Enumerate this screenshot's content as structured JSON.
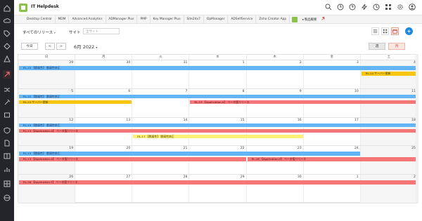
{
  "app": {
    "title": "IT Helpdesk"
  },
  "tabs": [
    "Desktop Central",
    "MDM",
    "Advanced Analytics",
    "ADManager Plus",
    "PMP",
    "Key Manager Plus",
    "Site24x7",
    "OpManager",
    "ADSelfService",
    "Zoho Creator App"
  ],
  "tab_extra": "製品概要",
  "filters": {
    "scope_label": "すべてのリリース",
    "site_label": "サイト",
    "site_placeholder": "全サイト"
  },
  "nav": {
    "today": "今日",
    "prev": "<",
    "next": ">",
    "month": "6月 2022",
    "week": "週",
    "month_view": "月"
  },
  "calendar": {
    "dow": [
      "日",
      "月",
      "火",
      "水",
      "木",
      "金",
      "土"
    ],
    "weeks": [
      {
        "days": [
          "29",
          "30",
          "31",
          "1",
          "2",
          "3",
          "4"
        ],
        "events": [
          {
            "label": "RL-15 【脆弱性】 脆弱性修正",
            "color": "blue",
            "start": 0,
            "span": 7,
            "row": 0
          },
          {
            "label": "RL-14 サーバー更新",
            "color": "yellow",
            "start": 6,
            "span": 1,
            "row": 1
          }
        ]
      },
      {
        "days": [
          "5",
          "6",
          "7",
          "8",
          "9",
          "10",
          "11"
        ],
        "events": [
          {
            "label": "RL-15 【脆弱性】 脆弱性修正",
            "color": "blue",
            "start": 0,
            "span": 7,
            "row": 0
          },
          {
            "label": "RL-14 サーバー更新",
            "color": "yellow",
            "start": 0,
            "span": 2,
            "row": 1
          },
          {
            "label": "RL-13 【Application-X】 ベータ版リリース",
            "color": "red",
            "start": 3,
            "span": 4,
            "row": 1
          }
        ]
      },
      {
        "days": [
          "12",
          "13",
          "14",
          "15",
          "16",
          "17",
          "18"
        ],
        "events": [
          {
            "label": "RL-15 【脆弱性】 脆弱性修正",
            "color": "blue",
            "start": 0,
            "span": 7,
            "row": 0
          },
          {
            "label": "RL-13 【Application-X】 ベータ版リリース",
            "color": "red",
            "start": 0,
            "span": 7,
            "row": 1
          },
          {
            "label": "RL-17 【脆弱性】 脆弱性修正",
            "color": "lightyellow",
            "start": 2,
            "span": 3,
            "row": 2
          }
        ]
      },
      {
        "days": [
          "19",
          "20",
          "21",
          "22",
          "23",
          "24",
          "25"
        ],
        "events": [
          {
            "label": "RL-15 【脆弱性】 脆弱性修正",
            "color": "blue",
            "start": 0,
            "span": 6,
            "row": 0
          },
          {
            "label": "RL-13 【Application-X】 ベータ版リリース",
            "color": "red",
            "start": 0,
            "span": 4,
            "row": 1
          },
          {
            "label": "RL-16 【Application-Y】 ベータ版リリース",
            "color": "red",
            "start": 4,
            "span": 3,
            "row": 1
          }
        ]
      },
      {
        "days": [
          "26",
          "27",
          "28",
          "29",
          "30",
          "1",
          "2"
        ],
        "events": [
          {
            "label": "RL-16 【Application-Y】 ベータ版リリース",
            "color": "red",
            "start": 0,
            "span": 7,
            "row": 0
          }
        ]
      }
    ]
  },
  "icons": {
    "sidebar": [
      "home-icon",
      "cloud-icon",
      "tag-icon",
      "diamond-icon",
      "alert-icon",
      "release-icon",
      "shuffle-icon",
      "tools-icon",
      "box-icon",
      "shield-icon",
      "doc-icon",
      "book-icon",
      "chart-icon",
      "grid-icon",
      "globe-icon"
    ],
    "header": [
      "search-icon",
      "history-icon",
      "help-icon",
      "lightning-icon",
      "clock-icon",
      "grid-apps-icon",
      "settings-icon",
      "user-icon"
    ]
  },
  "colors": {
    "sidebar": "#24252a",
    "blue_event": "#64b5f6",
    "red_event": "#f37777",
    "yellow_event": "#f6c611",
    "accent": "#c0392b"
  }
}
